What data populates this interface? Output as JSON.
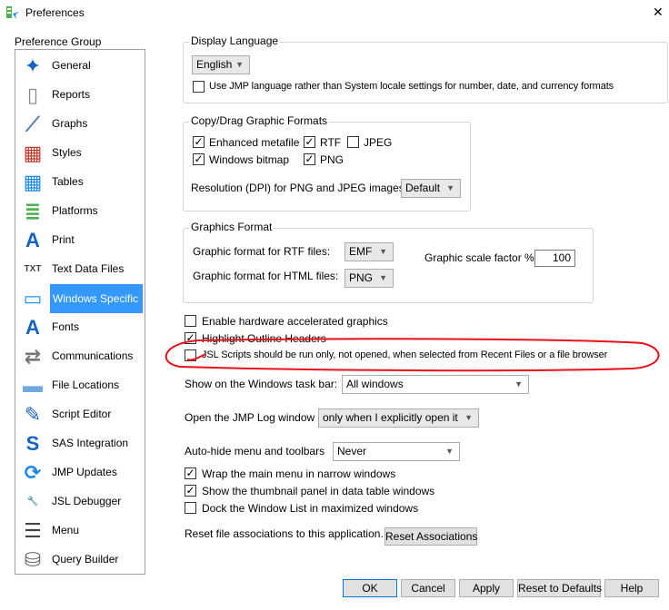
{
  "window": {
    "title": "Preferences",
    "close": "✕"
  },
  "sidebar": {
    "label": "Preference Group",
    "items": [
      {
        "label": "General",
        "icon": "general-icon"
      },
      {
        "label": "Reports",
        "icon": "reports-icon"
      },
      {
        "label": "Graphs",
        "icon": "graphs-icon"
      },
      {
        "label": "Styles",
        "icon": "styles-icon"
      },
      {
        "label": "Tables",
        "icon": "tables-icon"
      },
      {
        "label": "Platforms",
        "icon": "platforms-icon"
      },
      {
        "label": "Print",
        "icon": "print-icon"
      },
      {
        "label": "Text Data Files",
        "icon": "text-data-files-icon"
      },
      {
        "label": "Windows Specific",
        "icon": "monitor-icon",
        "selected": true
      },
      {
        "label": "Fonts",
        "icon": "fonts-icon"
      },
      {
        "label": "Communications",
        "icon": "communications-icon"
      },
      {
        "label": "File Locations",
        "icon": "folder-icon"
      },
      {
        "label": "Script Editor",
        "icon": "script-editor-icon"
      },
      {
        "label": "SAS Integration",
        "icon": "sas-icon"
      },
      {
        "label": "JMP Updates",
        "icon": "jmp-updates-icon"
      },
      {
        "label": "JSL Debugger",
        "icon": "wrench-icon"
      },
      {
        "label": "Menu",
        "icon": "menu-icon"
      },
      {
        "label": "Query Builder",
        "icon": "database-icon"
      }
    ]
  },
  "display_language": {
    "label": "Display Language",
    "language": "English",
    "use_jmp_language": {
      "label": "Use JMP language rather than System locale settings for number, date, and currency formats",
      "checked": false
    }
  },
  "copy_drag": {
    "label": "Copy/Drag Graphic Formats",
    "enhanced_metafile": {
      "label": "Enhanced metafile",
      "checked": true
    },
    "rtf": {
      "label": "RTF",
      "checked": true
    },
    "jpeg": {
      "label": "JPEG",
      "checked": false
    },
    "windows_bitmap": {
      "label": "Windows bitmap",
      "checked": true
    },
    "png": {
      "label": "PNG",
      "checked": true
    },
    "resolution_label": "Resolution (DPI) for PNG and JPEG images:",
    "resolution": "Default"
  },
  "graphics_format": {
    "label": "Graphics Format",
    "rtf_label": "Graphic format for RTF files:",
    "rtf_value": "EMF",
    "html_label": "Graphic format for HTML files:",
    "html_value": "PNG",
    "scale_label": "Graphic scale factor %",
    "scale_value": "100"
  },
  "options": [
    {
      "label": "Enable hardware accelerated graphics",
      "checked": false
    },
    {
      "label": "Highlight Outline Headers",
      "checked": true
    },
    {
      "label": "JSL Scripts should be run only, not opened, when selected from Recent Files or a file browser",
      "checked": false
    }
  ],
  "taskbar": {
    "label": "Show on the Windows task bar:",
    "value": "All windows"
  },
  "log": {
    "label": "Open the JMP Log window",
    "value": "only when I explicitly open it"
  },
  "autohide": {
    "label": "Auto-hide menu and toolbars",
    "value": "Never"
  },
  "options2": [
    {
      "label": "Wrap the main menu in narrow windows",
      "checked": true
    },
    {
      "label": "Show the thumbnail panel in data table windows",
      "checked": true
    },
    {
      "label": "Dock the Window List in maximized windows",
      "checked": false
    }
  ],
  "reset_assoc": {
    "label": "Reset file associations to this application.",
    "button": "Reset Associations"
  },
  "buttons": {
    "ok": "OK",
    "cancel": "Cancel",
    "apply": "Apply",
    "reset": "Reset to Defaults",
    "help": "Help"
  },
  "colors": {
    "selection": "#3399ff",
    "annotation": "#e8101a"
  }
}
